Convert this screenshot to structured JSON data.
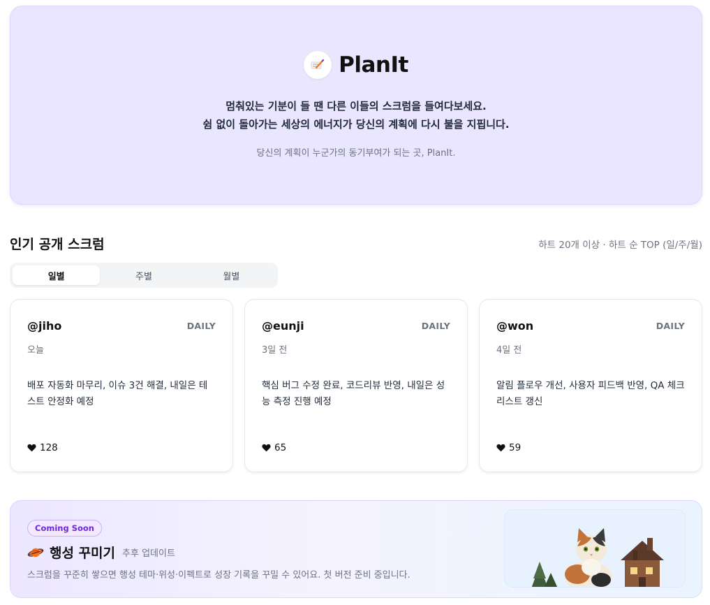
{
  "hero": {
    "brand": "PlanIt",
    "line1": "멈춰있는 기분이 들 땐 다른 이들의 스크럼을 들여다보세요.",
    "line2": "쉼 없이 돌아가는 세상의 에너지가 당신의 계획에 다시 불을 지핍니다.",
    "caption": "당신의 계획이 누군가의 동기부여가 되는 곳, PlanIt.",
    "logo_icon": "pencil-note-icon"
  },
  "popular": {
    "title": "인기 공개 스크럼",
    "note": "하트 20개 이상 · 하트 순 TOP (일/주/월)",
    "tabs": [
      {
        "label": "일별",
        "active": true
      },
      {
        "label": "주별",
        "active": false
      },
      {
        "label": "월별",
        "active": false
      }
    ],
    "cards": [
      {
        "user": "@jiho",
        "kind": "DAILY",
        "when": "오늘",
        "body": "배포 자동화 마무리, 이슈 3건 해결, 내일은 테스트 안정화 예정",
        "likes": "128"
      },
      {
        "user": "@eunji",
        "kind": "DAILY",
        "when": "3일 전",
        "body": "핵심 버그 수정 완료, 코드리뷰 반영, 내일은 성능 측정 진행 예정",
        "likes": "65"
      },
      {
        "user": "@won",
        "kind": "DAILY",
        "when": "4일 전",
        "body": "알림 플로우 개선, 사용자 피드백 반영, QA 체크리스트 갱신",
        "likes": "59"
      }
    ]
  },
  "promo": {
    "badge": "Coming Soon",
    "icon": "planet-icon",
    "title": "행성 꾸미기",
    "subtitle": "추후 업데이트",
    "description": "스크럼을 꾸준히 쌓으면 행성 테마·위성·이펙트로 성장 기록을 꾸밀 수 있어요. 첫 버전 준비 중입니다.",
    "illustration": "cat-illustration"
  },
  "colors": {
    "accent": "#6d28d9",
    "hero_bg": "#ebe6ff"
  }
}
